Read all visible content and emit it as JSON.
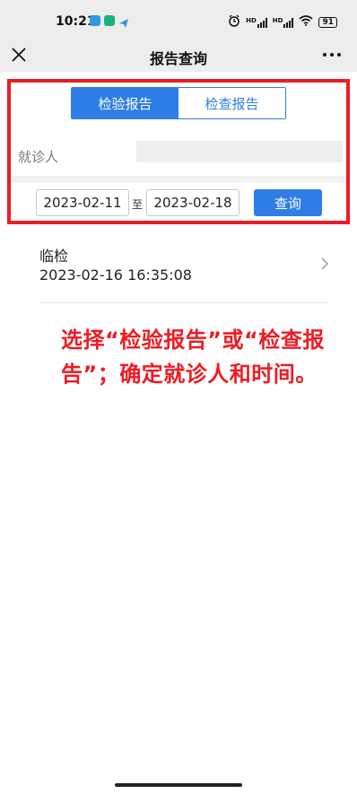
{
  "status_bar": {
    "time": "10:21",
    "battery": "91",
    "signal_label_1": "HD",
    "signal_label_2": "HD"
  },
  "nav": {
    "title": "报告查询"
  },
  "tabs": [
    {
      "label": "检验报告",
      "active": true
    },
    {
      "label": "检查报告",
      "active": false
    }
  ],
  "patient": {
    "label": "就诊人",
    "value": ""
  },
  "date_range": {
    "start": "2023-02-11",
    "separator": "至",
    "end": "2023-02-18"
  },
  "query_button": "查询",
  "reports": [
    {
      "type": "临检",
      "datetime": "2023-02-16 16:35:08"
    }
  ],
  "annotation": "选择“检验报告”或“检查报告”；确定就诊人和时间。",
  "colors": {
    "accent": "#2f7ee5",
    "highlight": "#ed1c24"
  },
  "icons": {
    "close": "close-icon",
    "more": "more-icon",
    "chevron": "chevron-right-icon",
    "alarm": "alarm-icon",
    "wifi": "wifi-icon"
  }
}
